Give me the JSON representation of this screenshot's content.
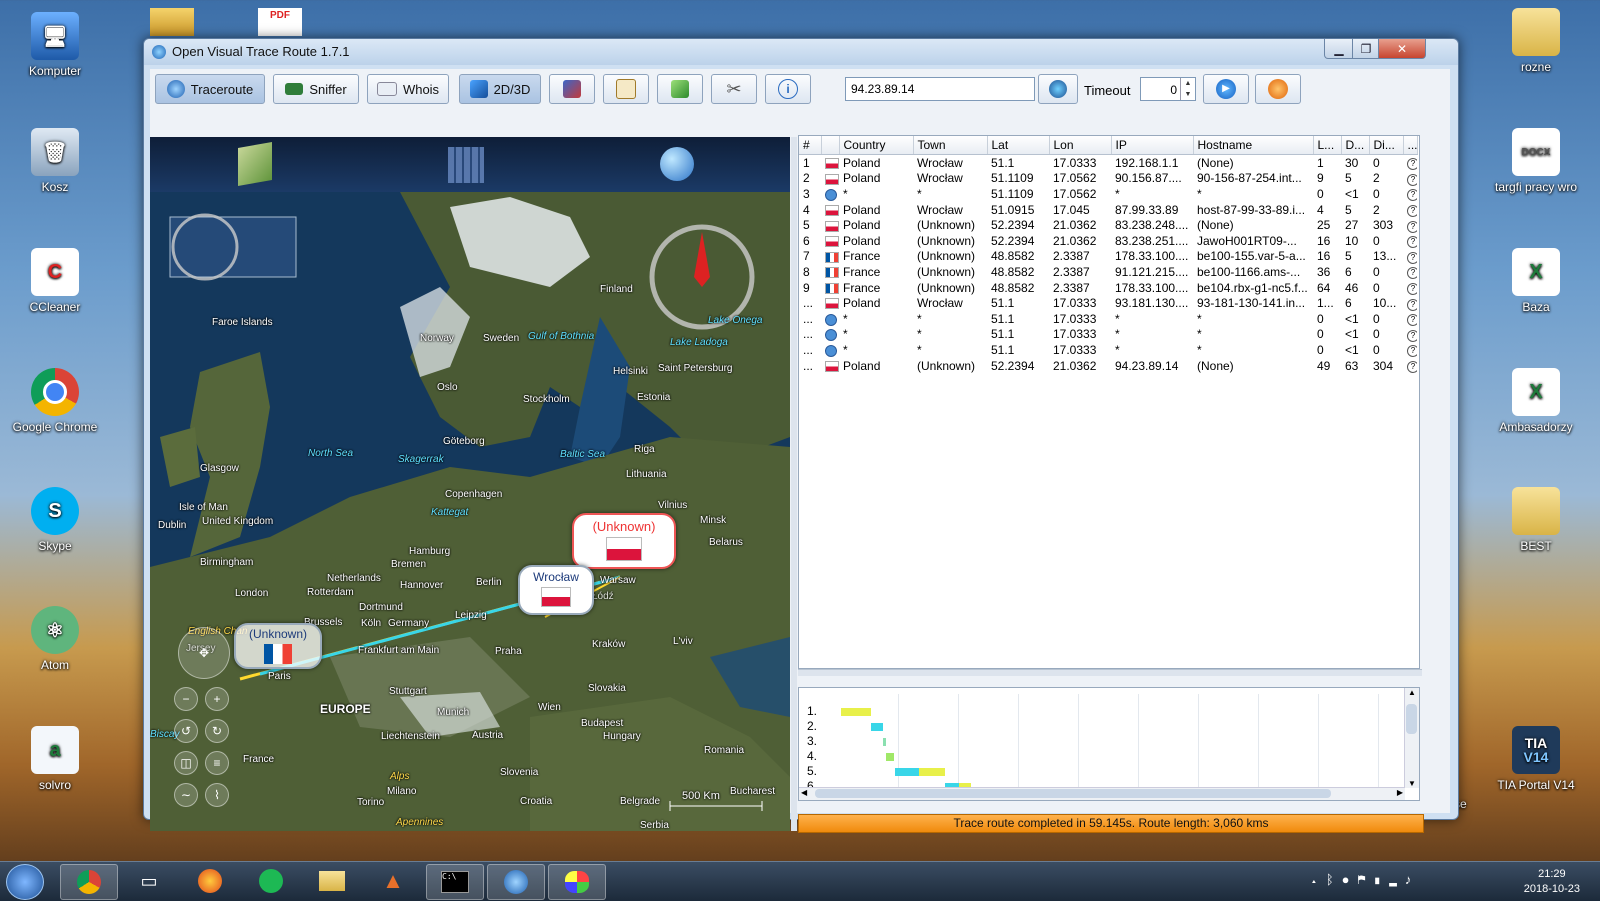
{
  "desktop": {
    "icons_left": [
      "Komputer",
      "Kosz",
      "CCleaner",
      "Google Chrome",
      "Skype",
      "Atom",
      "solvro"
    ],
    "icons_right": [
      "rozne",
      "targfi pracy wro",
      "Baza",
      "Ambasadorzy",
      "BEST",
      "TIA Portal V14"
    ],
    "docx_label": "DOCX",
    "tia_label": "TIA",
    "tia_sub": "V14",
    "partial_label": "nse"
  },
  "window": {
    "title": "Open Visual Trace Route 1.7.1",
    "min": "▁",
    "max": "❐",
    "close": "✕"
  },
  "toolbar": {
    "traceroute": "Traceroute",
    "sniffer": "Sniffer",
    "whois": "Whois",
    "view_mode": "2D/3D",
    "ip_value": "94.23.89.14",
    "timeout_label": "Timeout",
    "timeout_value": "0"
  },
  "map": {
    "scale_label": "500 Km",
    "bubble_unknown_pl": "(Unknown)",
    "bubble_wroclaw": "Wrocław",
    "bubble_unknown_fr": "(Unknown)",
    "labels": {
      "finland": "Finland",
      "faroe": "Faroe Islands",
      "sweden": "Sweden",
      "norway": "Norway",
      "gulf": "Gulf of Bothnia",
      "lake_ladoga": "Lake Ladoga",
      "lake_onega": "Lake Onega",
      "helsinki": "Helsinki",
      "stpete": "Saint Petersburg",
      "oslo": "Oslo",
      "stockholm": "Stockholm",
      "estonia": "Estonia",
      "north_sea": "North Sea",
      "skagerrak": "Skagerrak",
      "goteborg": "Göteborg",
      "riga": "Riga",
      "glasgow": "Glasgow",
      "baltic": "Baltic Sea",
      "lithuania": "Lithuania",
      "copenhagen": "Copenhagen",
      "kattegat": "Kattegat",
      "isle_of_man": "Isle of Man",
      "vilnius": "Vilnius",
      "dublin": "Dublin",
      "uk": "United Kingdom",
      "minsk": "Minsk",
      "hamburg": "Hamburg",
      "belarus": "Belarus",
      "bremen": "Bremen",
      "birmingham": "Birmingham",
      "netherlands": "Netherlands",
      "hannover": "Hannover",
      "berlin": "Berlin",
      "warsaw": "Warsaw",
      "london": "London",
      "rotterdam": "Rotterdam",
      "dortmund": "Dortmund",
      "lodz": "Łódź",
      "leipzig": "Leipzig",
      "brussels": "Brussels",
      "koln": "Köln",
      "germany": "Germany",
      "lviv": "L'viv",
      "krakow": "Kraków",
      "frankfurt": "Frankfurt am Main",
      "praha": "Praha",
      "paris": "Paris",
      "stuttgart": "Stuttgart",
      "slovakia": "Slovakia",
      "europe": "EUROPE",
      "munich": "Munich",
      "wien": "Wien",
      "budapest": "Budapest",
      "liechtenstein": "Liechtenstein",
      "austria": "Austria",
      "hungary": "Hungary",
      "france": "France",
      "romania": "Romania",
      "alps": "Alps",
      "slovenia": "Slovenia",
      "milano": "Milano",
      "bucharest": "Bucharest",
      "torino": "Torino",
      "croatia": "Croatia",
      "belgrade": "Belgrade",
      "apennines": "Apennines",
      "serbia": "Serbia",
      "biscay": "Biscay",
      "jersey": "Jersey",
      "english_channel": "English Chan"
    }
  },
  "table": {
    "columns": [
      "#",
      "",
      "Country",
      "Town",
      "Lat",
      "Lon",
      "IP",
      "Hostname",
      "L...",
      "D...",
      "Di...",
      "..."
    ],
    "rows": [
      {
        "n": "1",
        "flag": "pl",
        "country": "Poland",
        "town": "Wrocław",
        "lat": "51.1",
        "lon": "17.0333",
        "ip": "192.168.1.1",
        "host": "(None)",
        "l": "1",
        "d": "30",
        "di": "0"
      },
      {
        "n": "2",
        "flag": "pl",
        "country": "Poland",
        "town": "Wrocław",
        "lat": "51.1109",
        "lon": "17.0562",
        "ip": "90.156.87....",
        "host": "90-156-87-254.int...",
        "l": "9",
        "d": "5",
        "di": "2"
      },
      {
        "n": "3",
        "flag": "unk",
        "country": "*",
        "town": "*",
        "lat": "51.1109",
        "lon": "17.0562",
        "ip": "*",
        "host": "*",
        "l": "0",
        "d": "<1",
        "di": "0"
      },
      {
        "n": "4",
        "flag": "pl",
        "country": "Poland",
        "town": "Wrocław",
        "lat": "51.0915",
        "lon": "17.045",
        "ip": "87.99.33.89",
        "host": "host-87-99-33-89.i...",
        "l": "4",
        "d": "5",
        "di": "2"
      },
      {
        "n": "5",
        "flag": "pl",
        "country": "Poland",
        "town": "(Unknown)",
        "lat": "52.2394",
        "lon": "21.0362",
        "ip": "83.238.248....",
        "host": "(None)",
        "l": "25",
        "d": "27",
        "di": "303"
      },
      {
        "n": "6",
        "flag": "pl",
        "country": "Poland",
        "town": "(Unknown)",
        "lat": "52.2394",
        "lon": "21.0362",
        "ip": "83.238.251....",
        "host": "JawoH001RT09-...",
        "l": "16",
        "d": "10",
        "di": "0"
      },
      {
        "n": "7",
        "flag": "fr",
        "country": "France",
        "town": "(Unknown)",
        "lat": "48.8582",
        "lon": "2.3387",
        "ip": "178.33.100....",
        "host": "be100-155.var-5-a...",
        "l": "16",
        "d": "5",
        "di": "13..."
      },
      {
        "n": "8",
        "flag": "fr",
        "country": "France",
        "town": "(Unknown)",
        "lat": "48.8582",
        "lon": "2.3387",
        "ip": "91.121.215....",
        "host": "be100-1166.ams-...",
        "l": "36",
        "d": "6",
        "di": "0"
      },
      {
        "n": "9",
        "flag": "fr",
        "country": "France",
        "town": "(Unknown)",
        "lat": "48.8582",
        "lon": "2.3387",
        "ip": "178.33.100....",
        "host": "be104.rbx-g1-nc5.f...",
        "l": "64",
        "d": "46",
        "di": "0"
      },
      {
        "n": "...",
        "flag": "pl",
        "country": "Poland",
        "town": "Wrocław",
        "lat": "51.1",
        "lon": "17.0333",
        "ip": "93.181.130....",
        "host": "93-181-130-141.in...",
        "l": "1...",
        "d": "6",
        "di": "10..."
      },
      {
        "n": "...",
        "flag": "unk",
        "country": "*",
        "town": "*",
        "lat": "51.1",
        "lon": "17.0333",
        "ip": "*",
        "host": "*",
        "l": "0",
        "d": "<1",
        "di": "0"
      },
      {
        "n": "...",
        "flag": "unk",
        "country": "*",
        "town": "*",
        "lat": "51.1",
        "lon": "17.0333",
        "ip": "*",
        "host": "*",
        "l": "0",
        "d": "<1",
        "di": "0"
      },
      {
        "n": "...",
        "flag": "unk",
        "country": "*",
        "town": "*",
        "lat": "51.1",
        "lon": "17.0333",
        "ip": "*",
        "host": "*",
        "l": "0",
        "d": "<1",
        "di": "0"
      },
      {
        "n": "...",
        "flag": "pl",
        "country": "Poland",
        "town": "(Unknown)",
        "lat": "52.2394",
        "lon": "21.0362",
        "ip": "94.23.89.14",
        "host": "(None)",
        "l": "49",
        "d": "63",
        "di": "304"
      }
    ]
  },
  "gantt": {
    "labels": [
      "1.",
      "2.",
      "3.",
      "4.",
      "5.",
      "6."
    ],
    "colors": {
      "yellow": "#e8f04a",
      "cyan": "#39d6e8"
    }
  },
  "status": "Trace route completed in 59.145s. Route length: 3,060 kms",
  "taskbar": {
    "time": "21:29",
    "date": "2018-10-23"
  }
}
